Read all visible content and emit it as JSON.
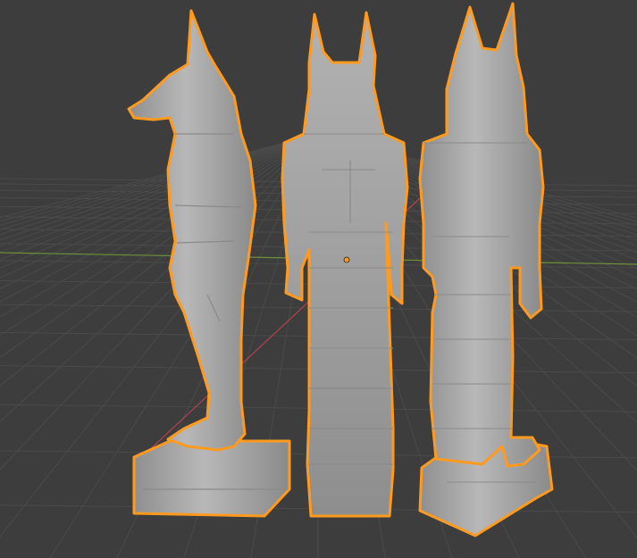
{
  "viewport": {
    "background": "#3d3d3d",
    "grid_color": "#4a4a4a",
    "x_axis_color": "#b0434f",
    "y_axis_color": "#6f8f3a",
    "selection_outline": "#ff9a1f",
    "mesh_color": "#a9a9a9",
    "origin_color": "#ff9a1f"
  },
  "objects": [
    {
      "id": "anubis-side",
      "view": "side",
      "selected": true
    },
    {
      "id": "anubis-back",
      "view": "back",
      "selected": true
    },
    {
      "id": "anubis-back-three-quarter",
      "view": "back-three-quarter",
      "selected": true
    }
  ],
  "icons": {
    "origin": "object-origin-dot-icon"
  }
}
